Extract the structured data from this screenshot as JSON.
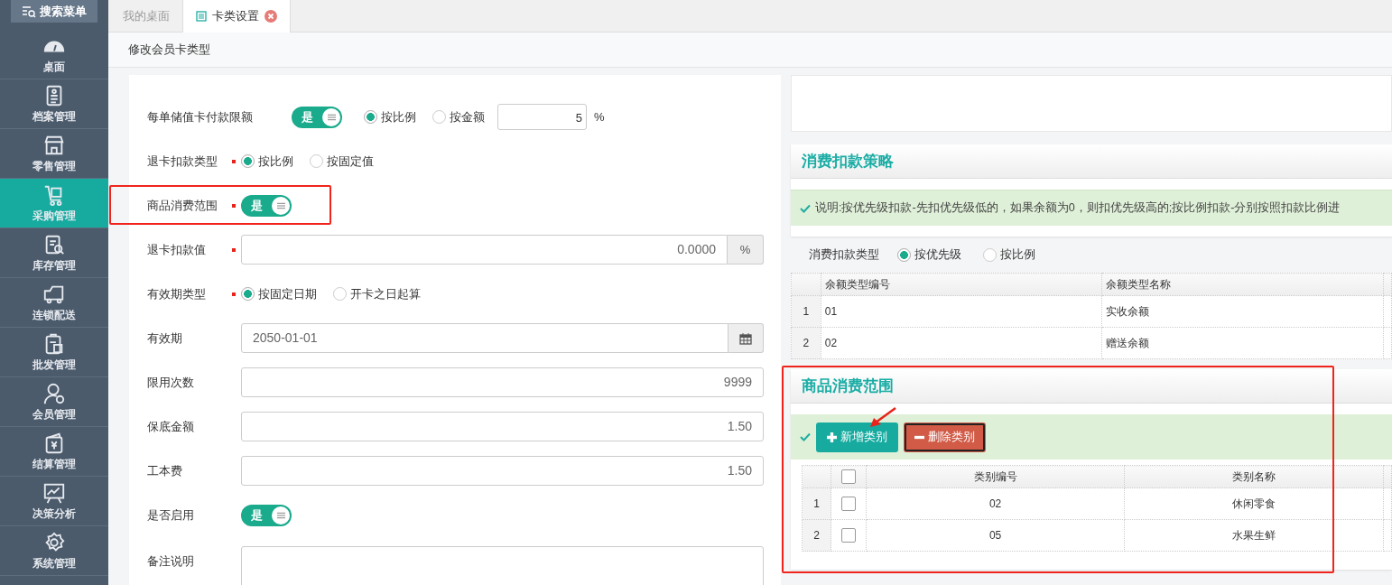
{
  "search_menu": {
    "label": "搜索菜单"
  },
  "sidebar": {
    "items": [
      {
        "label": "桌面",
        "selected": false
      },
      {
        "label": "档案管理",
        "selected": false
      },
      {
        "label": "零售管理",
        "selected": false
      },
      {
        "label": "采购管理",
        "selected": true
      },
      {
        "label": "库存管理",
        "selected": false
      },
      {
        "label": "连锁配送",
        "selected": false
      },
      {
        "label": "批发管理",
        "selected": false
      },
      {
        "label": "会员管理",
        "selected": false
      },
      {
        "label": "结算管理",
        "selected": false
      },
      {
        "label": "决策分析",
        "selected": false
      },
      {
        "label": "系统管理",
        "selected": false
      }
    ]
  },
  "tabs": [
    {
      "label": "我的桌面",
      "selected": false,
      "closable": false
    },
    {
      "label": "卡类设置",
      "selected": true,
      "closable": true
    }
  ],
  "page_title": "修改会员卡类型",
  "form": {
    "rows": [
      {
        "kind": "limit",
        "label": "每单储值卡付款限额",
        "required": false,
        "highlighted": false,
        "toggle": {
          "label": "是",
          "on": true
        },
        "options": [
          {
            "label": "按比例",
            "selected": true
          },
          {
            "label": "按金额",
            "selected": false
          }
        ],
        "value": "5",
        "unit": "%"
      },
      {
        "kind": "radio",
        "label": "退卡扣款类型",
        "required": true,
        "highlighted": false,
        "options": [
          {
            "label": "按比例",
            "selected": true
          },
          {
            "label": "按固定值",
            "selected": false
          }
        ]
      },
      {
        "kind": "toggle",
        "label": "商品消费范围",
        "required": true,
        "highlighted": true,
        "toggle": {
          "label": "是",
          "on": true
        }
      },
      {
        "kind": "number",
        "label": "退卡扣款值",
        "required": true,
        "highlighted": false,
        "value": "0.0000",
        "addon": "%"
      },
      {
        "kind": "radio",
        "label": "有效期类型",
        "required": true,
        "highlighted": false,
        "options": [
          {
            "label": "按固定日期",
            "selected": true
          },
          {
            "label": "开卡之日起算",
            "selected": false
          }
        ]
      },
      {
        "kind": "date",
        "label": "有效期",
        "required": false,
        "highlighted": false,
        "value": "2050-01-01"
      },
      {
        "kind": "number",
        "label": "限用次数",
        "required": false,
        "highlighted": false,
        "value": "9999"
      },
      {
        "kind": "number",
        "label": "保底金额",
        "required": false,
        "highlighted": false,
        "value": "1.50"
      },
      {
        "kind": "number",
        "label": "工本费",
        "required": false,
        "highlighted": false,
        "value": "1.50"
      },
      {
        "kind": "toggle",
        "label": "是否启用",
        "required": false,
        "highlighted": false,
        "toggle": {
          "label": "是",
          "on": true
        }
      },
      {
        "kind": "textarea",
        "label": "备注说明",
        "required": false,
        "highlighted": false
      }
    ]
  },
  "deduction_strategy": {
    "title": "消费扣款策略",
    "note": "说明:按优先级扣款-先扣优先级低的，如果余额为0，则扣优先级高的;按比例扣款-分别按照扣款比例进",
    "type_label": "消费扣款类型",
    "options": [
      {
        "label": "按优先级",
        "selected": true
      },
      {
        "label": "按比例",
        "selected": false
      }
    ],
    "table": {
      "columns": [
        "余额类型编号",
        "余额类型名称"
      ],
      "rows": [
        {
          "index": "1",
          "cells": [
            "01",
            "实收余额"
          ]
        },
        {
          "index": "2",
          "cells": [
            "02",
            "赠送余额"
          ]
        }
      ]
    }
  },
  "scope": {
    "title": "商品消费范围",
    "highlighted": true,
    "buttons": [
      {
        "label": "新增类别",
        "kind": "add"
      },
      {
        "label": "删除类别",
        "kind": "delete"
      }
    ],
    "table": {
      "columns": [
        "类别编号",
        "类别名称"
      ],
      "header_checked": false,
      "rows": [
        {
          "index": "1",
          "checked": false,
          "cells": [
            "02",
            "休闲零食"
          ]
        },
        {
          "index": "2",
          "checked": false,
          "cells": [
            "05",
            "水果生鲜"
          ]
        }
      ]
    }
  }
}
